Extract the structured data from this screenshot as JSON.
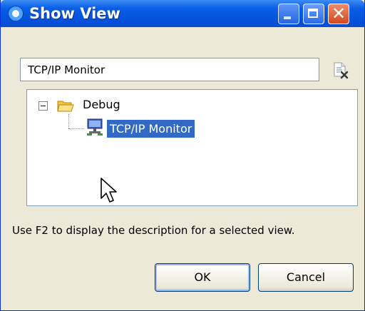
{
  "window": {
    "title": "Show View"
  },
  "title_buttons": {
    "minimize_icon": "minimize-icon",
    "maximize_icon": "maximize-icon",
    "close_icon": "close-icon",
    "close_glyph": "✕"
  },
  "filter": {
    "value": "TCP/IP Monitor",
    "clear_icon": "clear-filter-icon"
  },
  "tree": {
    "nodes": [
      {
        "label": "Debug",
        "icon": "folder-icon",
        "expanded": true,
        "children": [
          {
            "label": "TCP/IP Monitor",
            "icon": "tcpip-monitor-icon",
            "selected": true
          }
        ]
      }
    ]
  },
  "description": "Use F2 to display the description for a selected view.",
  "buttons": {
    "ok": "OK",
    "cancel": "Cancel"
  },
  "colors": {
    "titlebar": "#0a5ee7",
    "selection": "#316ac5",
    "dialog_bg": "#ece9d8",
    "border": "#7f9db9"
  }
}
